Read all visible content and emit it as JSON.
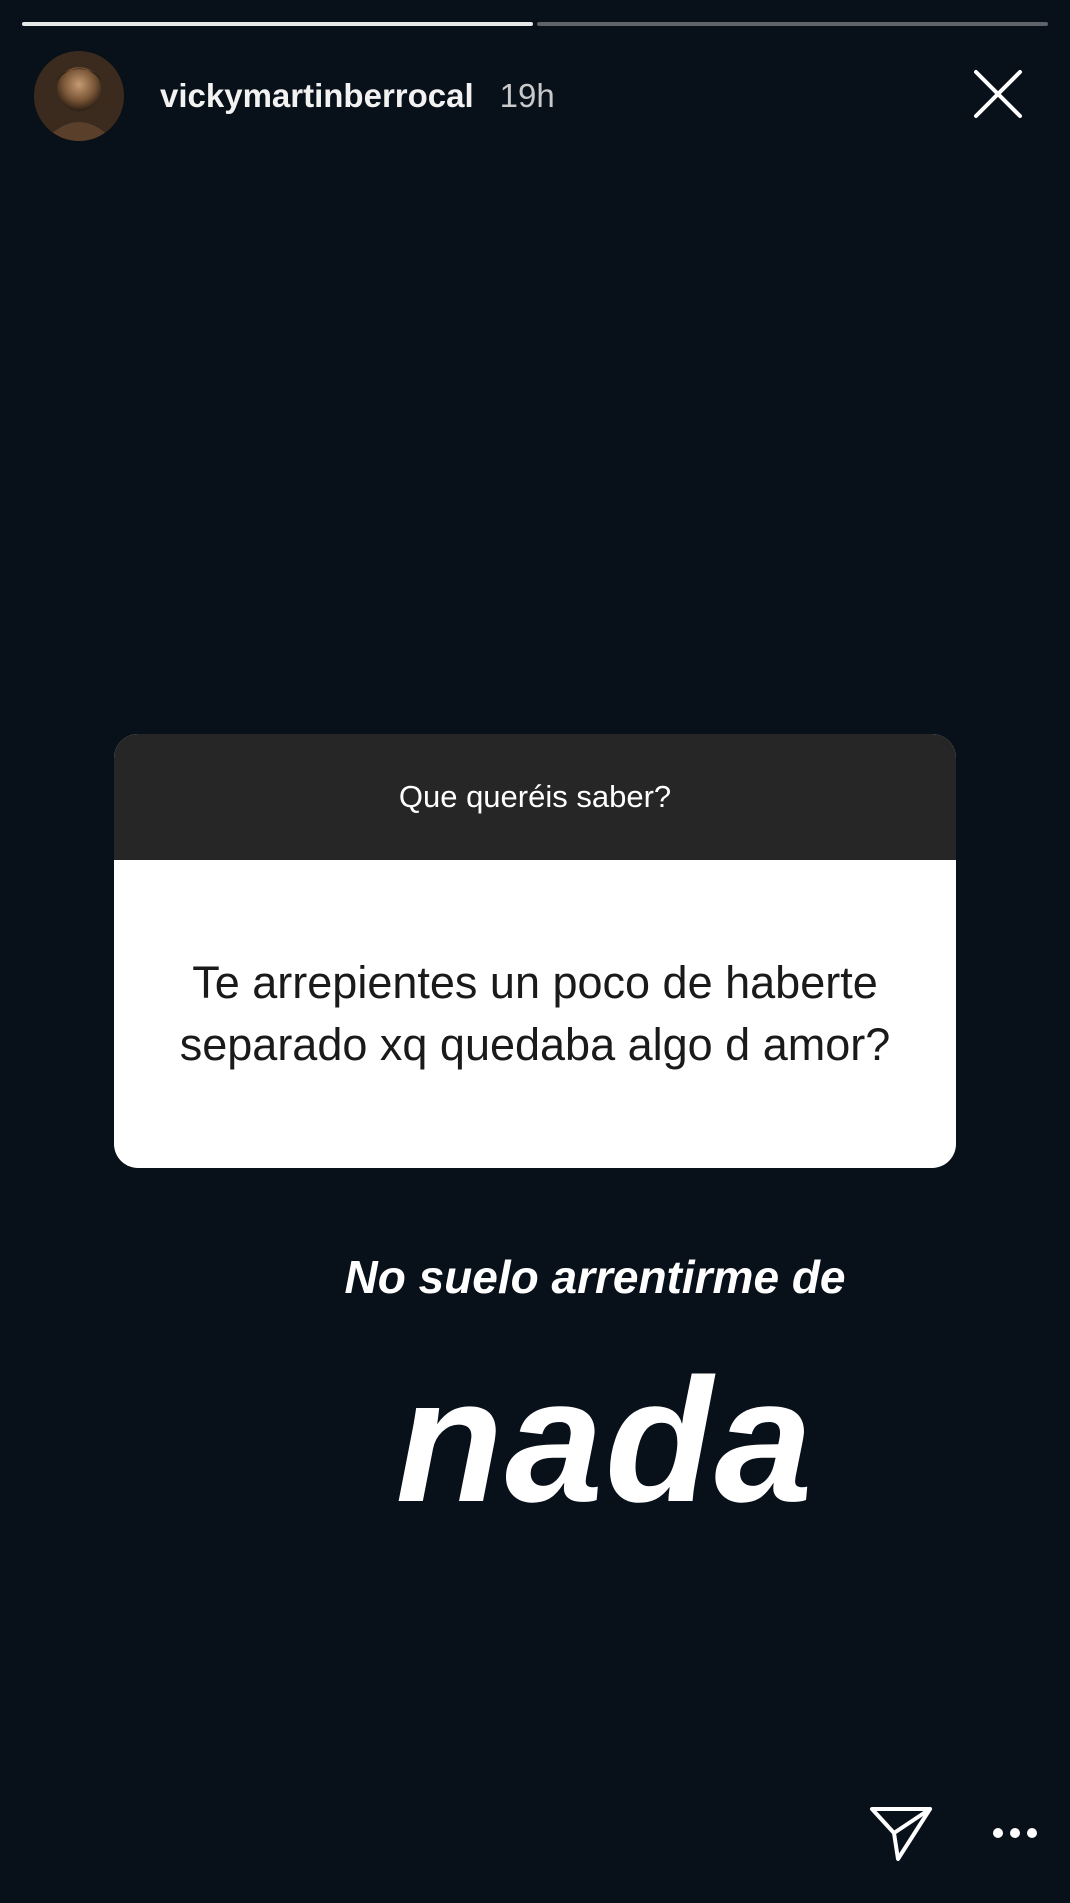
{
  "story": {
    "username": "vickymartinberrocal",
    "timestamp": "19h",
    "segments_total": 2,
    "segments_seen": 1
  },
  "question_sticker": {
    "prompt": "Que queréis saber?",
    "question": "Te arrepientes un poco de haberte separado xq quedaba algo d amor?"
  },
  "answer": {
    "line1": "No suelo arrentirme de",
    "line2": "nada"
  },
  "icons": {
    "close": "close-icon",
    "share": "paper-plane-icon",
    "more": "more-dots-icon"
  }
}
